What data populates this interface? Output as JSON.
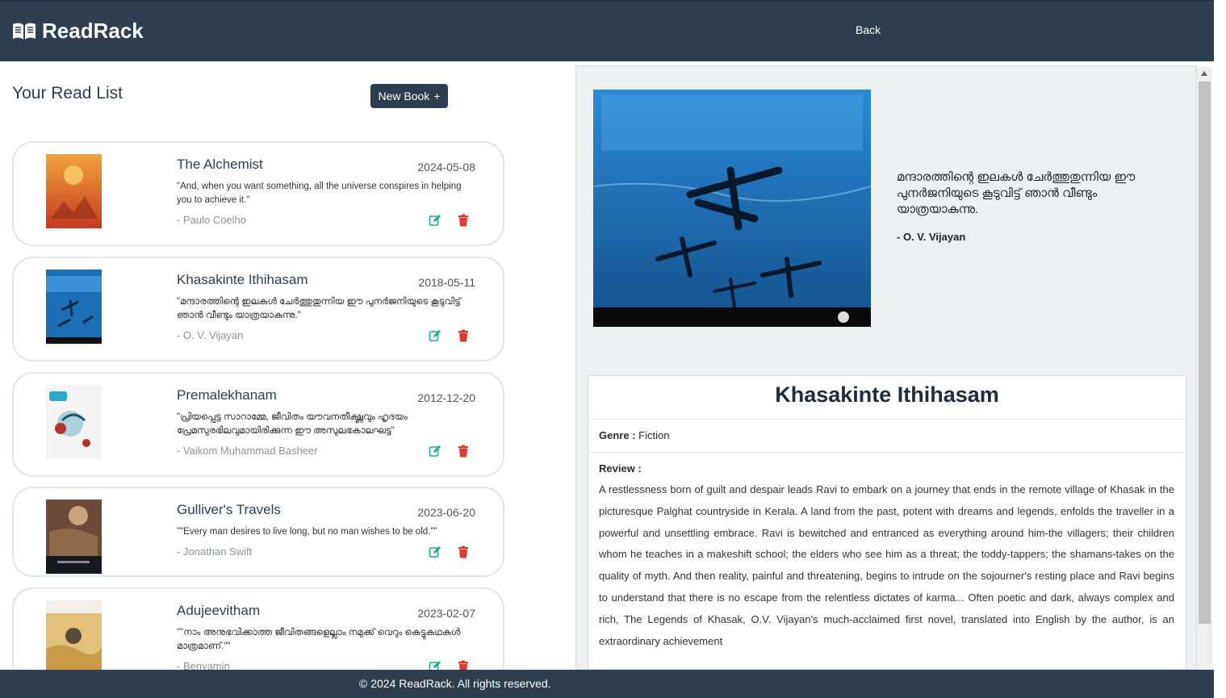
{
  "header": {
    "brand": "ReadRack",
    "back_label": "Back"
  },
  "readlist": {
    "title": "Your Read List",
    "new_book_label": "New Book",
    "new_book_icon": "+",
    "books": [
      {
        "title": "The Alchemist",
        "date": "2024-05-08",
        "quote": "\"And, when you want something, all the universe conspires in helping you to achieve it.\"",
        "author": "- Paulo Coelho",
        "cover_color": "#d9572b"
      },
      {
        "title": "Khasakinte Ithihasam",
        "date": "2018-05-11",
        "quote": "\"മന്ദാരത്തിന്റെ ഇലകൾ ചേർത്തുതുന്നിയ ഈ പുനർജനിയുടെ കൂടുവിട്ട് ഞാൻ വീണ്ടും യാത്രയാകുന്നു.\"",
        "author": "- O. V. Vijayan",
        "cover_color": "#1d6fb5"
      },
      {
        "title": "Premalekhanam",
        "date": "2012-12-20",
        "quote": "\"പ്രിയപ്പെട്ട സാറാമ്മേ, ജീവിതം യൗവനതീക്ഷ്ണവും ഹൃദയം പ്രേമസുരഭിലവുമായിരിക്കുന്ന ഈ അസുലഭകാലഘട്ട\"",
        "author": "- Vaikom Muhammad Basheer",
        "cover_color": "#f2f2f2"
      },
      {
        "title": "Gulliver's Travels",
        "date": "2023-06-20",
        "quote": "\"\"Every man desires to live long, but no man wishes to be old.\"\"",
        "author": "- Jonathan Swift",
        "cover_color": "#6b4a3a"
      },
      {
        "title": "Adujeevitham",
        "date": "2023-02-07",
        "quote": "\"\"നാം അനുഭവിക്കാത്ത ജീവിതങ്ങളെല്ലാം നമുക്ക് വെറും കെട്ടുകഥകൾ മാത്രമാണ്.\"\"",
        "author": "- Benyamin",
        "cover_color": "#e2c27a"
      }
    ]
  },
  "detail": {
    "quote": "മന്ദാരത്തിന്റെ ഇലകൾ ചേർത്തുതുന്നിയ ഈ പുനർജനിയുടെ കൂടുവിട്ട് ഞാൻ വീണ്ടും യാത്രയാകുന്നു.",
    "author": "- O. V. Vijayan",
    "book_title": "Khasakinte Ithihasam",
    "genre_label": "Genre :",
    "genre": "Fiction",
    "review_label": "Review :",
    "review": "A restlessness born of guilt and despair leads Ravi to embark on a journey that ends in the remote village of Khasak in the picturesque Palghat countryside in Kerala. A land from the past, potent with dreams and legends, enfolds the traveller in a powerful and unsettling embrace. Ravi is bewitched and entranced as everything around him-the villagers; their children whom he teaches in a makeshift school; the elders who see him as a threat; the toddy-tappers; the shamans-takes on the quality of myth. And then reality, painful and threatening, begins to intrude on the sojourner's resting place and Ravi begins to understand that there is no escape from the relentless dictates of karma... Often poetic and dark, always complex and rich, The Legends of Khasak, O.V. Vijayan's much-acclaimed first novel, translated into English by the author, is an extraordinary achievement"
  },
  "footer": {
    "text": "© 2024 ReadRack. All rights reserved."
  },
  "colors": {
    "navbar": "#2c3e50",
    "edit": "#1aab8a",
    "delete": "#e03a2f",
    "panel": "#ecf0f1"
  }
}
